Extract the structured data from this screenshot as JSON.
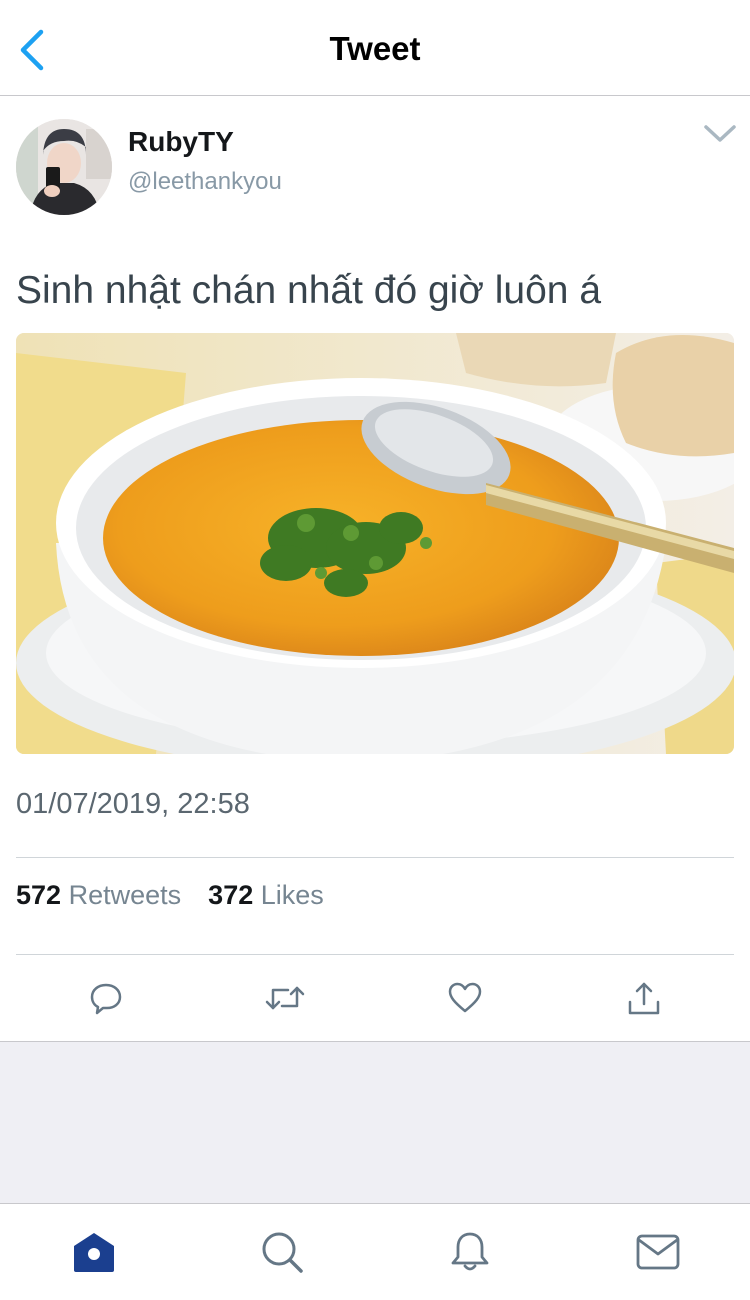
{
  "nav": {
    "title": "Tweet",
    "back_icon": "chevron-left-icon"
  },
  "tweet": {
    "display_name": "RubyTY",
    "handle": "@leethankyou",
    "text": "Sinh nhật chán nhất đó giờ luôn á",
    "timestamp": "01/07/2019, 22:58",
    "retweets_count": "572",
    "retweets_label": "Retweets",
    "likes_count": "372",
    "likes_label": "Likes"
  },
  "actions": [
    "reply-icon",
    "retweet-icon",
    "like-icon",
    "share-icon"
  ],
  "tabbar": [
    "home-icon",
    "search-icon",
    "notifications-icon",
    "messages-icon"
  ],
  "colors": {
    "accent": "#1da1f2",
    "tab_active": "#1b3f8f",
    "icon_gray": "#657786",
    "muted_text": "#8899a6"
  }
}
